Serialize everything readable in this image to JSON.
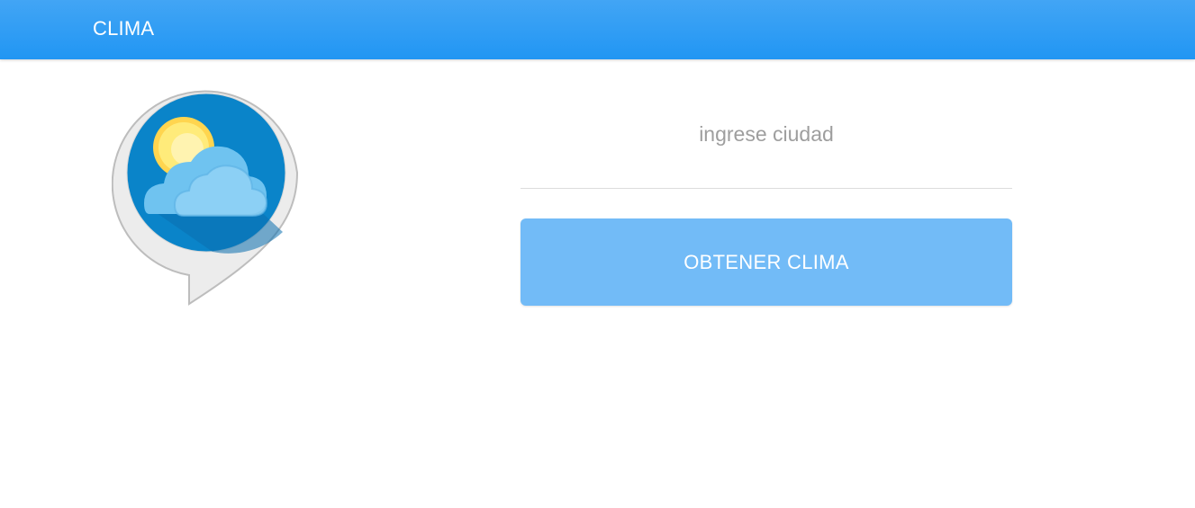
{
  "header": {
    "title": "CLIMA",
    "background_color": "#2196f3"
  },
  "logo": {
    "icon": "weather-sun-cloud-icon"
  },
  "form": {
    "city_placeholder": "ingrese ciudad",
    "city_value": "",
    "submit_label": "OBTENER CLIMA",
    "submit_color": "#72bbf7"
  }
}
